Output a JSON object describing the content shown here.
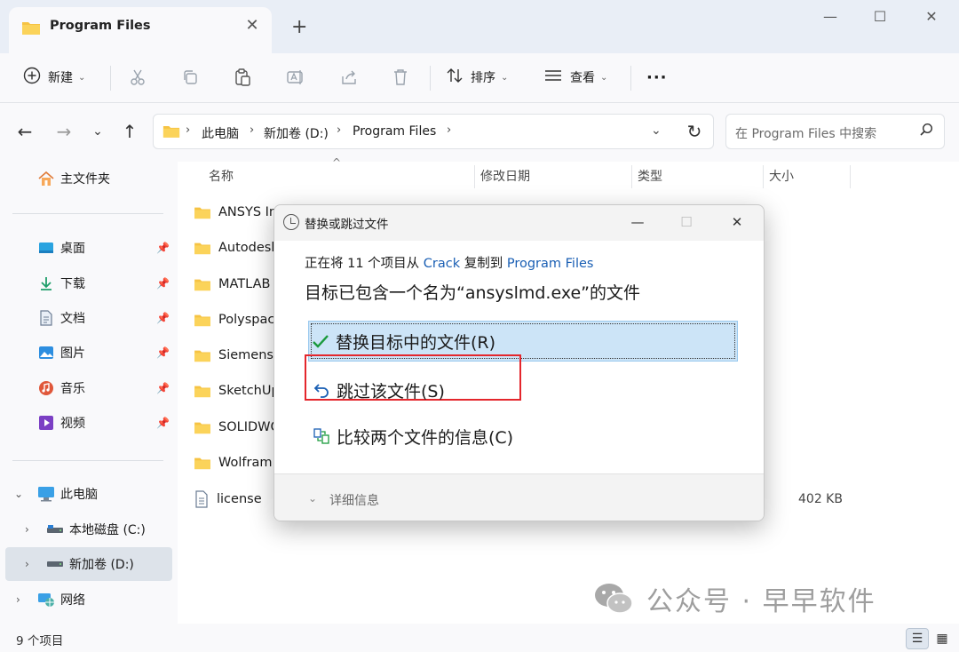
{
  "window": {
    "tab_title": "Program Files",
    "new_tab": "+",
    "minimize": "—",
    "maximize": "☐",
    "close": "✕"
  },
  "toolbar": {
    "new_label": "新建",
    "sort_label": "排序",
    "view_label": "查看",
    "more_label": "···"
  },
  "address": {
    "crumbs": [
      "此电脑",
      "新加卷 (D:)",
      "Program Files"
    ],
    "search_placeholder": "在 Program Files 中搜索"
  },
  "sidebar": {
    "home": "主文件夹",
    "quick": [
      {
        "label": "桌面",
        "icon": "desktop-icon"
      },
      {
        "label": "下载",
        "icon": "download-icon"
      },
      {
        "label": "文档",
        "icon": "document-icon"
      },
      {
        "label": "图片",
        "icon": "picture-icon"
      },
      {
        "label": "音乐",
        "icon": "music-icon"
      },
      {
        "label": "视频",
        "icon": "video-icon"
      }
    ],
    "this_pc": "此电脑",
    "drive_c": "本地磁盘 (C:)",
    "drive_d": "新加卷 (D:)",
    "network": "网络"
  },
  "columns": {
    "name": "名称",
    "modified": "修改日期",
    "type": "类型",
    "size": "大小"
  },
  "files": [
    {
      "name": "ANSYS In",
      "kind": "folder"
    },
    {
      "name": "Autodesk",
      "kind": "folder"
    },
    {
      "name": "MATLAB",
      "kind": "folder"
    },
    {
      "name": "Polyspace",
      "kind": "folder"
    },
    {
      "name": "Siemens",
      "kind": "folder"
    },
    {
      "name": "SketchUp",
      "kind": "folder"
    },
    {
      "name": "SOLIDWO",
      "kind": "folder"
    },
    {
      "name": "Wolfram",
      "kind": "folder"
    },
    {
      "name": "license",
      "kind": "file",
      "size": "402 KB"
    }
  ],
  "status": {
    "count": "9 个项目"
  },
  "dialog": {
    "title": "替换或跳过文件",
    "line1_prefix": "正在将 11 个项目从 ",
    "source": "Crack",
    "line1_mid": " 复制到 ",
    "dest": "Program Files",
    "line2": "目标已包含一个名为“ansyslmd.exe”的文件",
    "option_replace": "替换目标中的文件(R)",
    "option_skip": "跳过该文件(S)",
    "option_compare": "比较两个文件的信息(C)",
    "details": "详细信息"
  },
  "watermark": {
    "text": "公众号 · 早早软件"
  },
  "colors": {
    "accent": "#1a5fb4",
    "selection": "#cce4f7",
    "highlight_box": "#e4262c",
    "folder": "#f6c343"
  }
}
